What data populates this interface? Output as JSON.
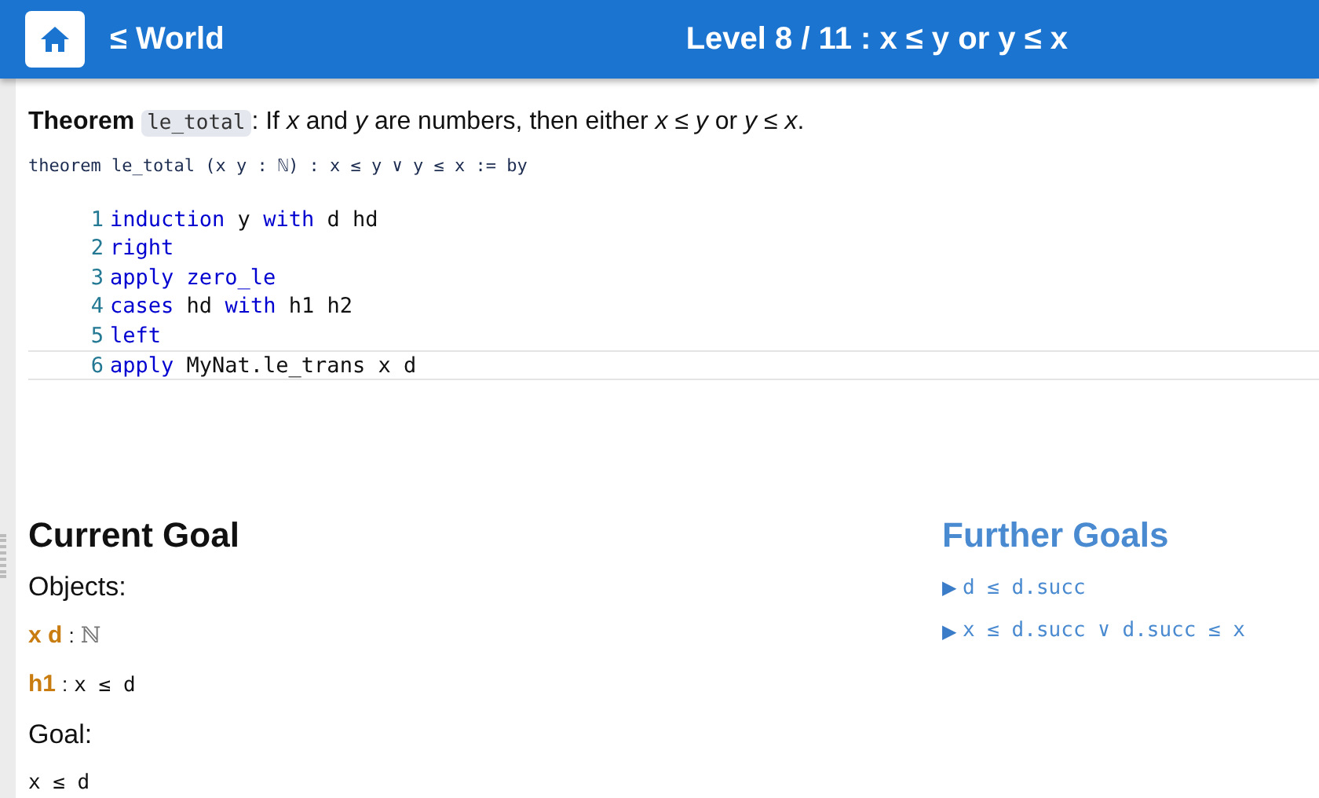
{
  "header": {
    "world": "≤ World",
    "level": "Level 8 / 11 : x ≤ y or y ≤ x"
  },
  "theorem": {
    "label": "Theorem",
    "name": "le_total",
    "statement": ": If *x* and *y* are numbers, then either *x ≤ y* or *y ≤ x*.",
    "signature": "theorem le_total (x y : ℕ) : x ≤ y ∨ y ≤ x := by"
  },
  "code_lines": [
    {
      "number": "1",
      "current": false,
      "tokens": [
        {
          "text": "induction",
          "kind": "keyword"
        },
        {
          "text": "y",
          "kind": "ident"
        },
        {
          "text": "with",
          "kind": "keyword"
        },
        {
          "text": "d",
          "kind": "ident"
        },
        {
          "text": "hd",
          "kind": "ident"
        }
      ]
    },
    {
      "number": "2",
      "current": false,
      "tokens": [
        {
          "text": "right",
          "kind": "keyword"
        }
      ]
    },
    {
      "number": "3",
      "current": false,
      "tokens": [
        {
          "text": "apply",
          "kind": "keyword"
        },
        {
          "text": "zero_le",
          "kind": "keyword"
        }
      ]
    },
    {
      "number": "4",
      "current": false,
      "tokens": [
        {
          "text": "cases",
          "kind": "keyword"
        },
        {
          "text": "hd",
          "kind": "ident"
        },
        {
          "text": "with",
          "kind": "keyword"
        },
        {
          "text": "h1",
          "kind": "ident"
        },
        {
          "text": "h2",
          "kind": "ident"
        }
      ]
    },
    {
      "number": "5",
      "current": false,
      "tokens": [
        {
          "text": "left",
          "kind": "keyword"
        }
      ]
    },
    {
      "number": "6",
      "current": true,
      "tokens": [
        {
          "text": "apply",
          "kind": "keyword"
        },
        {
          "text": "MyNat.le_trans",
          "kind": "ident"
        },
        {
          "text": "x",
          "kind": "ident"
        },
        {
          "text": "d",
          "kind": "ident"
        }
      ]
    }
  ],
  "current_goal": {
    "title": "Current Goal",
    "objects_label": "Objects:",
    "hypotheses": [
      {
        "names": "x d",
        "separator": ":",
        "kind": "object",
        "type": "ℕ"
      },
      {
        "names": "h1",
        "separator": ":",
        "kind": "proof",
        "type": "x ≤ d"
      }
    ],
    "goal_label": "Goal:",
    "goal": "x ≤ d"
  },
  "further_goals": {
    "title": "Further Goals",
    "items": [
      {
        "marker": "▶",
        "text": "d ≤ d.succ"
      },
      {
        "marker": "▶",
        "text": "x ≤ d.succ ∨ d.succ ≤ x"
      }
    ]
  }
}
